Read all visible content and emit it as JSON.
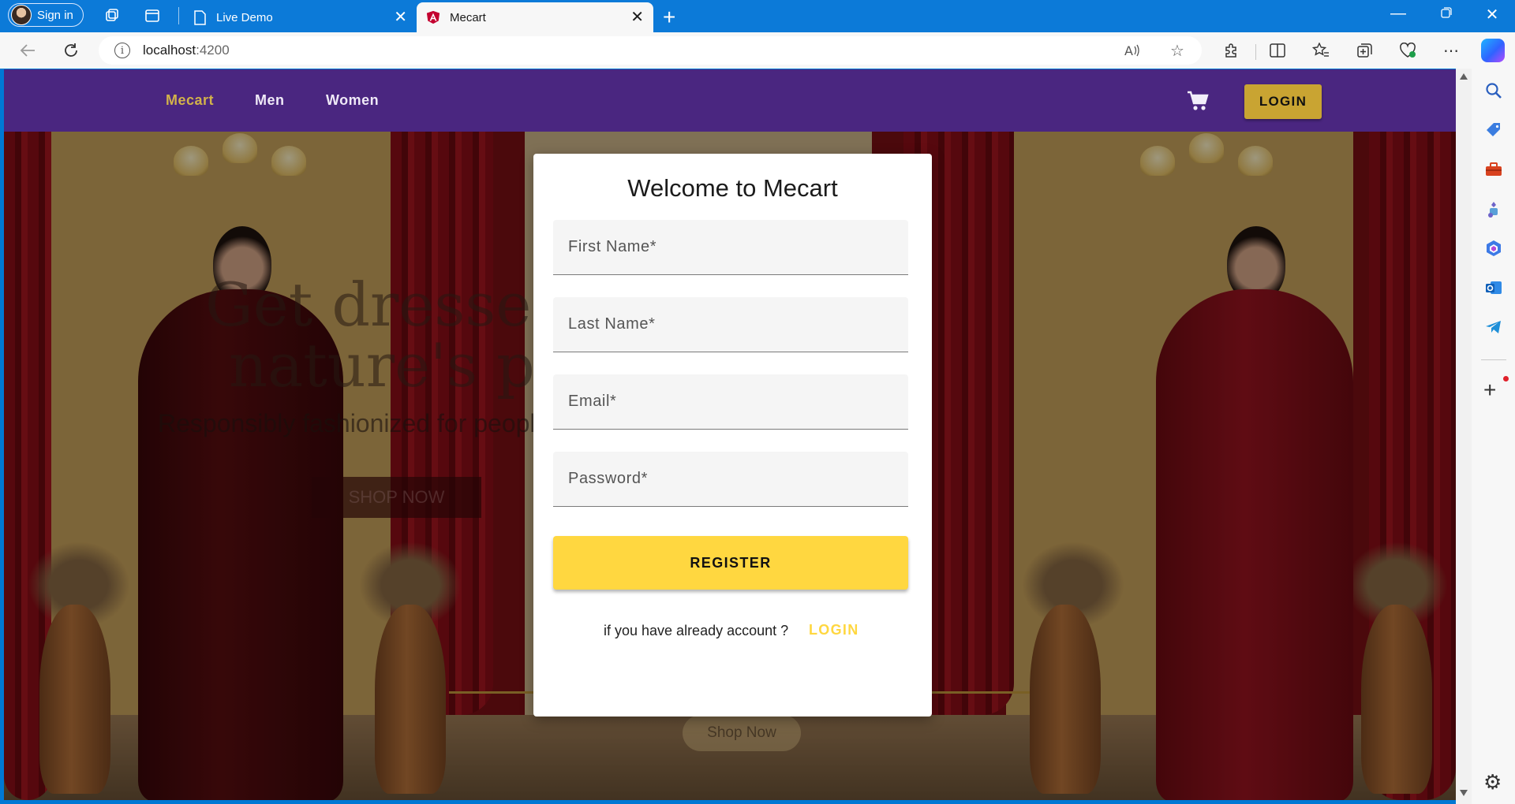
{
  "browser": {
    "profile_label": "Sign in",
    "tabs": [
      {
        "title": "Live Demo",
        "active": false
      },
      {
        "title": "Mecart",
        "active": true
      }
    ],
    "new_tab_symbol": "+",
    "window_controls": [
      "minimize",
      "restore",
      "close"
    ],
    "address_bar": {
      "host": "localhost",
      "port": ":4200",
      "info_symbol": "i"
    },
    "toolbar_icons": [
      "read-aloud-icon",
      "favorite-star-icon",
      "extensions-icon",
      "split-screen-icon",
      "favorites-icon",
      "collections-icon",
      "browser-essentials-icon",
      "more-icon",
      "copilot-icon"
    ],
    "sidebar_icons": [
      "search-icon",
      "shopping-tag-icon",
      "tools-icon",
      "games-icon",
      "microsoft-365-icon",
      "outlook-icon",
      "telegram-icon",
      "add-icon",
      "settings-icon"
    ],
    "colors": {
      "tab_strip": "#0c7ad8",
      "toolbar": "#f7f7f7"
    }
  },
  "app": {
    "nav": {
      "brand": "Mecart",
      "links": [
        "Men",
        "Women"
      ],
      "login_label": "LOGIN",
      "cart_icon": "shopping-cart-icon"
    },
    "register_card": {
      "title": "Welcome to Mecart",
      "fields": [
        {
          "placeholder": "First Name*",
          "value": ""
        },
        {
          "placeholder": "Last Name*",
          "value": ""
        },
        {
          "placeholder": "Email*",
          "value": ""
        },
        {
          "placeholder": "Password*",
          "value": ""
        }
      ],
      "register_label": "REGISTER",
      "already_text": "if you have already account ?",
      "login_link": "LOGIN"
    },
    "hero_background_text": {
      "headline_line1": "Get dressed wi",
      "headline_line2": "nature's puri",
      "subline": "Responsibly fashionized for people",
      "shop_now_1": "SHOP NOW",
      "shop_now_2": "Shop Now"
    },
    "colors": {
      "header_bg": "#4a2680",
      "brand_link": "#d2b24a",
      "login_button": "#c9a432",
      "register_button": "#ffd740",
      "login_link": "#ffd740"
    }
  }
}
